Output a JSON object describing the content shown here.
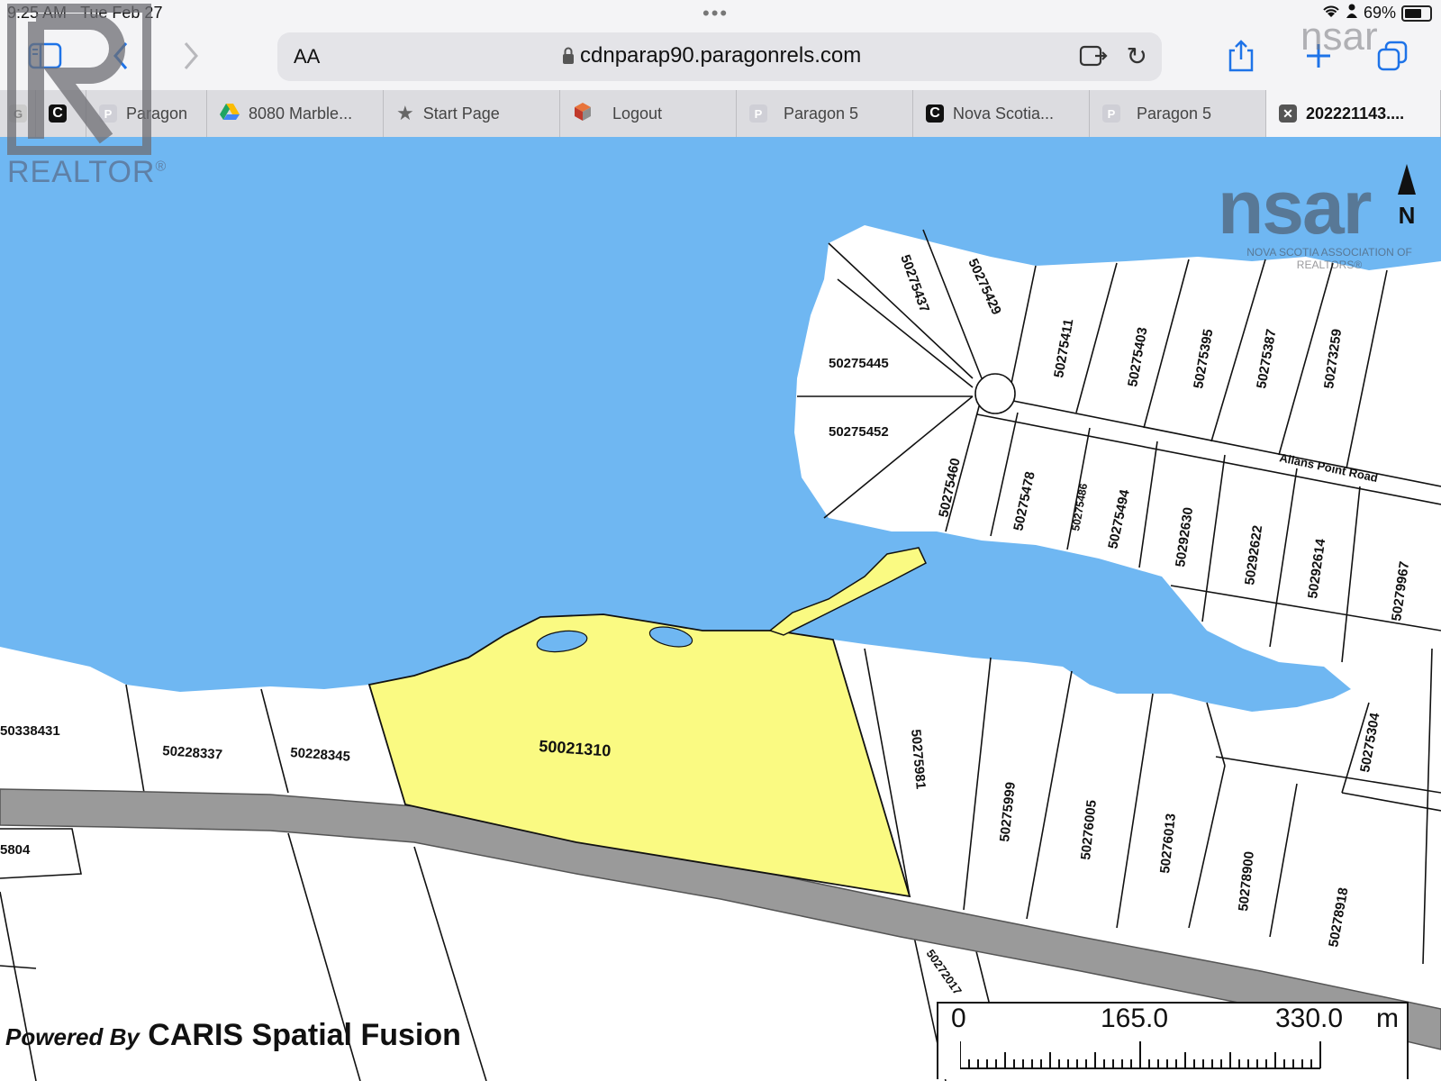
{
  "status_bar": {
    "time": "9:25 AM",
    "date": "Tue Feb 27",
    "battery": "69%",
    "battery_level": 0.69,
    "dots": "•••"
  },
  "toolbar": {
    "text_size": "AA",
    "url": "cdnparap90.paragonrels.com"
  },
  "tabs": [
    {
      "label": "G",
      "icon": "g-favicon"
    },
    {
      "label": "",
      "icon": "c-favicon"
    },
    {
      "label": "Paragon",
      "icon": "p-favicon"
    },
    {
      "label": "8080 Marble...",
      "icon": "google-drive-icon"
    },
    {
      "label": "Start Page",
      "icon": "star-icon"
    },
    {
      "label": "Logout",
      "icon": "logout-favicon"
    },
    {
      "label": "Paragon 5",
      "icon": "p-favicon"
    },
    {
      "label": "Nova Scotia...",
      "icon": "c-favicon"
    },
    {
      "label": "Paragon 5",
      "icon": "p-favicon"
    },
    {
      "label": "202221143....",
      "icon": "close-icon"
    }
  ],
  "watermarks": {
    "realtor": "REALTOR",
    "realtor_mark": "®",
    "nsar_small": "nsar",
    "nsar": "nsar",
    "nsar_sub": "NOVA SCOTIA ASSOCIATION OF REALTORS®"
  },
  "map": {
    "north": "N",
    "road": "Allans Point Road",
    "subject_parcel": "50021310",
    "parcels": {
      "p1": "50275437",
      "p2": "50275429",
      "p3": "50275411",
      "p4": "50275403",
      "p5": "50275395",
      "p6": "50275387",
      "p7": "50273259",
      "p8": "50275445",
      "p9": "50275452",
      "p10": "50275460",
      "p11": "50275478",
      "p12": "50275486",
      "p13": "50275494",
      "p14": "50292630",
      "p15": "50292622",
      "p16": "50292614",
      "p17": "50279967",
      "p18": "50275304",
      "p19": "50275981",
      "p20": "50275999",
      "p21": "50276005",
      "p22": "50276013",
      "p23": "50278900",
      "p24": "50278918",
      "p25": "50228337",
      "p26": "50228345",
      "p27": "50338431",
      "p28": "50272017",
      "p29": "5804"
    },
    "credit_prefix": "Powered By",
    "credit": "CARIS Spatial Fusion",
    "scale": {
      "start": "0",
      "mid": "165.0",
      "end": "330.0",
      "unit": "m"
    }
  },
  "colors": {
    "water": "#6fb7f2",
    "subject": "#fafa82",
    "road": "#9a9a9a",
    "accent": "#1e73e8"
  }
}
